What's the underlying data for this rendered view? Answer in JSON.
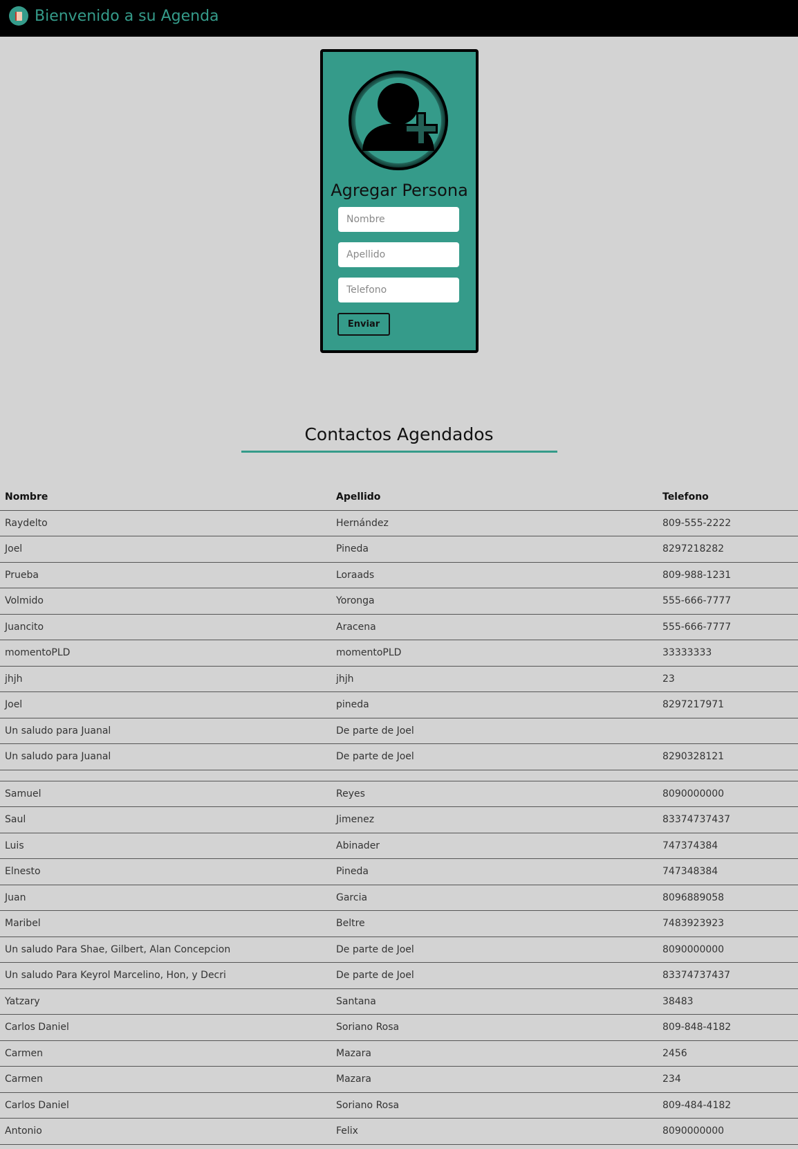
{
  "header": {
    "title": "Bienvenido a su Agenda",
    "logo_icon": "agenda-book-icon"
  },
  "form": {
    "icon": "add-user-icon",
    "title": "Agregar Persona",
    "nombre_placeholder": "Nombre",
    "apellido_placeholder": "Apellido",
    "telefono_placeholder": "Telefono",
    "submit_label": "Enviar"
  },
  "contacts": {
    "title": "Contactos Agendados",
    "columns": [
      "Nombre",
      "Apellido",
      "Telefono"
    ],
    "rows": [
      [
        "Raydelto",
        "Hernández",
        "809-555-2222"
      ],
      [
        "Joel",
        "Pineda",
        "8297218282"
      ],
      [
        "Prueba",
        "Loraads",
        "809-988-1231"
      ],
      [
        "Volmido",
        "Yoronga",
        "555-666-7777"
      ],
      [
        "Juancito",
        "Aracena",
        "555-666-7777"
      ],
      [
        "momentoPLD",
        "momentoPLD",
        "33333333"
      ],
      [
        "jhjh",
        "jhjh",
        "23"
      ],
      [
        "Joel",
        "pineda",
        "8297217971"
      ],
      [
        "Un saludo para Juanal",
        "De parte de Joel",
        ""
      ],
      [
        "Un saludo para Juanal",
        "De parte de Joel",
        "8290328121"
      ],
      [
        "",
        "",
        ""
      ],
      [
        "Samuel",
        "Reyes",
        "8090000000"
      ],
      [
        "Saul",
        "Jimenez",
        "83374737437"
      ],
      [
        "Luis",
        "Abinader",
        "747374384"
      ],
      [
        "Elnesto",
        "Pineda",
        "747348384"
      ],
      [
        "Juan",
        "Garcia",
        "8096889058"
      ],
      [
        "Maribel",
        "Beltre",
        "7483923923"
      ],
      [
        "Un saludo Para Shae, Gilbert, Alan Concepcion",
        "De parte de Joel",
        "8090000000"
      ],
      [
        "Un saludo Para Keyrol Marcelino, Hon, y Decri",
        "De parte de Joel",
        "83374737437"
      ],
      [
        "Yatzary",
        "Santana",
        "38483"
      ],
      [
        "Carlos Daniel",
        "Soriano Rosa",
        "809-848-4182"
      ],
      [
        "Carmen",
        "Mazara",
        "2456"
      ],
      [
        "Carmen",
        "Mazara",
        "234"
      ],
      [
        "Carlos Daniel",
        "Soriano Rosa",
        "809-484-4182"
      ],
      [
        "Antonio",
        "Felix",
        "8090000000"
      ]
    ]
  }
}
